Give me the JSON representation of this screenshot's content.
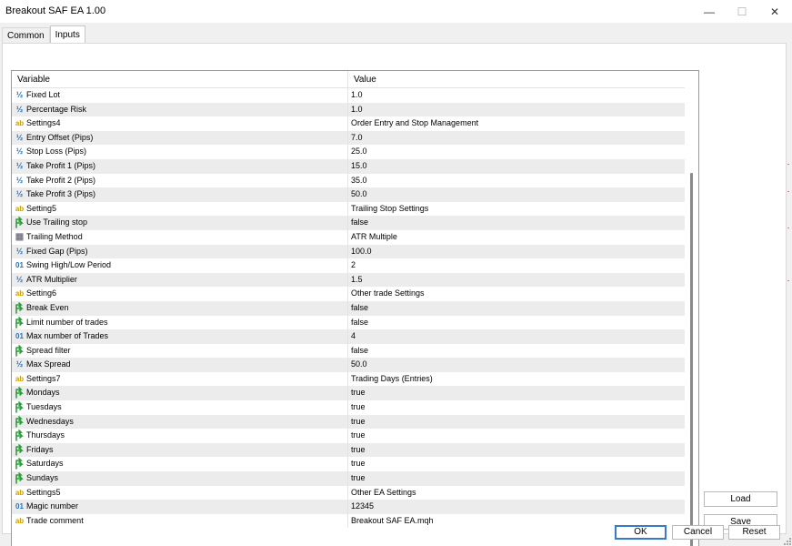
{
  "window": {
    "title": "Breakout SAF EA 1.00",
    "controls": {
      "minimize": "—",
      "maximize": "☐",
      "close": "✕"
    }
  },
  "tabs": [
    {
      "label": "Common",
      "active": false
    },
    {
      "label": "Inputs",
      "active": true
    }
  ],
  "columns": {
    "variable": "Variable",
    "value": "Value"
  },
  "rows": [
    {
      "type": "double",
      "icon": "double-icon",
      "name": "Fixed Lot",
      "value": "1.0"
    },
    {
      "type": "double",
      "icon": "double-icon",
      "name": "Percentage Risk",
      "value": "1.0"
    },
    {
      "type": "string",
      "icon": "string-icon",
      "name": "Settings4",
      "value": "Order Entry and Stop Management"
    },
    {
      "type": "double",
      "icon": "double-icon",
      "name": "Entry Offset (Pips)",
      "value": "7.0"
    },
    {
      "type": "double",
      "icon": "double-icon",
      "name": "Stop Loss (Pips)",
      "value": "25.0"
    },
    {
      "type": "double",
      "icon": "double-icon",
      "name": "Take Profit 1 (Pips)",
      "value": "15.0"
    },
    {
      "type": "double",
      "icon": "double-icon",
      "name": "Take Profit 2 (Pips)",
      "value": "35.0"
    },
    {
      "type": "double",
      "icon": "double-icon",
      "name": "Take Profit 3 (Pips)",
      "value": "50.0"
    },
    {
      "type": "string",
      "icon": "string-icon",
      "name": "Setting5",
      "value": "Trailing Stop Settings"
    },
    {
      "type": "bool",
      "icon": "bool-icon",
      "name": "Use Trailing stop",
      "value": "false"
    },
    {
      "type": "enum",
      "icon": "enum-icon",
      "name": "Trailing Method",
      "value": "ATR Multiple"
    },
    {
      "type": "double",
      "icon": "double-icon",
      "name": "Fixed Gap (Pips)",
      "value": "100.0"
    },
    {
      "type": "int",
      "icon": "int-icon",
      "name": "Swing High/Low Period",
      "value": "2"
    },
    {
      "type": "double",
      "icon": "double-icon",
      "name": "ATR Multiplier",
      "value": "1.5"
    },
    {
      "type": "string",
      "icon": "string-icon",
      "name": "Setting6",
      "value": "Other trade Settings"
    },
    {
      "type": "bool",
      "icon": "bool-icon",
      "name": "Break Even",
      "value": "false"
    },
    {
      "type": "bool",
      "icon": "bool-icon",
      "name": "Limit number of trades",
      "value": "false"
    },
    {
      "type": "int",
      "icon": "int-icon",
      "name": "Max number of Trades",
      "value": "4"
    },
    {
      "type": "bool",
      "icon": "bool-icon",
      "name": "Spread filter",
      "value": "false"
    },
    {
      "type": "double",
      "icon": "double-icon",
      "name": "Max Spread",
      "value": "50.0"
    },
    {
      "type": "string",
      "icon": "string-icon",
      "name": "Settings7",
      "value": "Trading Days (Entries)"
    },
    {
      "type": "bool",
      "icon": "bool-icon",
      "name": "Mondays",
      "value": "true"
    },
    {
      "type": "bool",
      "icon": "bool-icon",
      "name": "Tuesdays",
      "value": "true"
    },
    {
      "type": "bool",
      "icon": "bool-icon",
      "name": "Wednesdays",
      "value": "true"
    },
    {
      "type": "bool",
      "icon": "bool-icon",
      "name": "Thursdays",
      "value": "true"
    },
    {
      "type": "bool",
      "icon": "bool-icon",
      "name": "Fridays",
      "value": "true"
    },
    {
      "type": "bool",
      "icon": "bool-icon",
      "name": "Saturdays",
      "value": "true"
    },
    {
      "type": "bool",
      "icon": "bool-icon",
      "name": "Sundays",
      "value": "true"
    },
    {
      "type": "string",
      "icon": "string-icon",
      "name": "Settings5",
      "value": "Other EA Settings"
    },
    {
      "type": "int",
      "icon": "int-icon",
      "name": "Magic number",
      "value": "12345"
    },
    {
      "type": "string",
      "icon": "string-icon",
      "name": "Trade comment",
      "value": "Breakout SAF EA.mqh"
    }
  ],
  "icon_glyphs": {
    "double": "½",
    "string": "ab",
    "int": "01",
    "enum": "▦"
  },
  "buttons": {
    "load": "Load",
    "save": "Save",
    "ok": "OK",
    "cancel": "Cancel",
    "reset": "Reset"
  },
  "colors": {
    "accent": "#3a78c8",
    "alt_row": "#ececec",
    "bool_icon": "#2e9e3a",
    "double_icon": "#2d6fb8",
    "string_icon": "#c8a000"
  }
}
